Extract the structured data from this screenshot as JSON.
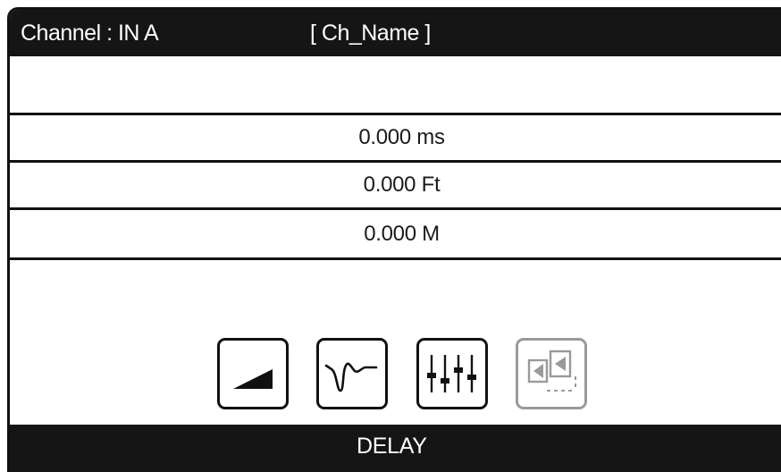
{
  "header": {
    "channel_label": "Channel : IN A",
    "channel_name": "[ Ch_Name ]"
  },
  "delay_values": {
    "ms": "0.000 ms",
    "ft": "0.000 Ft",
    "m": "0.000 M"
  },
  "toolbar": {
    "buttons": [
      {
        "icon": "gain-ramp-icon",
        "active": true
      },
      {
        "icon": "eq-curve-icon",
        "active": true
      },
      {
        "icon": "fader-sliders-icon",
        "active": true
      },
      {
        "icon": "delay-speaker-icon",
        "active": false
      }
    ]
  },
  "footer": {
    "label": "DELAY"
  },
  "colors": {
    "bar_background": "#151515",
    "bar_text": "#ffffff",
    "border": "#111111",
    "inactive_icon": "#9a9a9a"
  }
}
